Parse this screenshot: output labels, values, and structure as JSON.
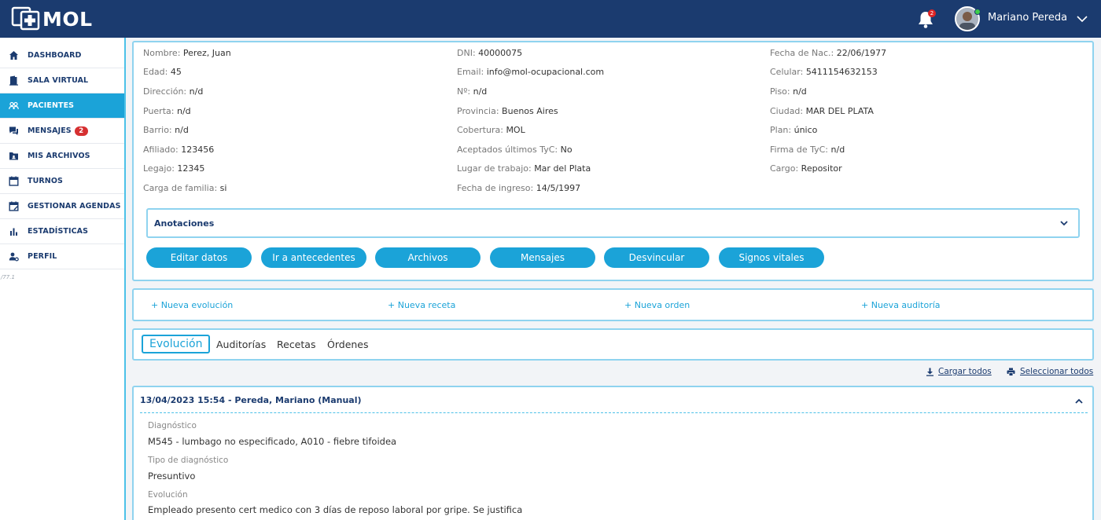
{
  "header": {
    "logo_text": "MOL",
    "notification_count": "2",
    "user_name": "Mariano Pereda"
  },
  "sidebar": {
    "items": [
      {
        "label": "DASHBOARD",
        "icon": "home-icon"
      },
      {
        "label": "SALA VIRTUAL",
        "icon": "door-icon"
      },
      {
        "label": "PACIENTES",
        "icon": "users-icon",
        "active": true
      },
      {
        "label": "MENSAJES",
        "icon": "chat-icon",
        "badge": "2"
      },
      {
        "label": "MIS ARCHIVOS",
        "icon": "folder-icon"
      },
      {
        "label": "TURNOS",
        "icon": "calendar-icon"
      },
      {
        "label": "GESTIONAR AGENDAS",
        "icon": "calendar-edit-icon"
      },
      {
        "label": "ESTADÍSTICAS",
        "icon": "bar-chart-icon"
      },
      {
        "label": "PERFIL",
        "icon": "user-gear-icon"
      }
    ],
    "version": "/77.1"
  },
  "patient": {
    "col1": [
      {
        "label": "Nombre:",
        "value": "Perez, Juan"
      },
      {
        "label": "Edad:",
        "value": "45"
      },
      {
        "label": "Dirección:",
        "value": "n/d"
      },
      {
        "label": "Puerta:",
        "value": "n/d"
      },
      {
        "label": "Barrio:",
        "value": "n/d"
      },
      {
        "label": "Afiliado:",
        "value": "123456"
      },
      {
        "label": "Legajo:",
        "value": "12345"
      },
      {
        "label": "Carga de familia:",
        "value": "si"
      }
    ],
    "col2": [
      {
        "label": "DNI:",
        "value": "40000075"
      },
      {
        "label": "Email:",
        "value": "info@mol-ocupacional.com"
      },
      {
        "label": "Nº:",
        "value": "n/d"
      },
      {
        "label": "Provincia:",
        "value": "Buenos Aires"
      },
      {
        "label": "Cobertura:",
        "value": "MOL"
      },
      {
        "label": "Aceptados últimos TyC:",
        "value": "No"
      },
      {
        "label": "Lugar de trabajo:",
        "value": "Mar del Plata"
      },
      {
        "label": "Fecha de ingreso:",
        "value": "14/5/1997"
      }
    ],
    "col3": [
      {
        "label": "Fecha de Nac.:",
        "value": "22/06/1977"
      },
      {
        "label": "Celular:",
        "value": "5411154632153"
      },
      {
        "label": "Piso:",
        "value": "n/d"
      },
      {
        "label": "Ciudad:",
        "value": "MAR DEL PLATA"
      },
      {
        "label": "Plan:",
        "value": "único"
      },
      {
        "label": "Firma de TyC:",
        "value": "n/d"
      },
      {
        "label": "Cargo:",
        "value": "Repositor"
      }
    ]
  },
  "annotations": {
    "label": "Anotaciones"
  },
  "buttons": {
    "edit": "Editar datos",
    "history": "Ir a antecedentes",
    "files": "Archivos",
    "messages": "Mensajes",
    "unlink": "Desvincular",
    "vitals": "Signos vitales"
  },
  "quick_actions": {
    "new_evolution": "+ Nueva evolución",
    "new_prescription": "+ Nueva receta",
    "new_order": "+ Nueva orden",
    "new_audit": "+ Nueva auditoría"
  },
  "tabs": {
    "evolution": "Evolución",
    "audits": "Auditorías",
    "prescriptions": "Recetas",
    "orders": "Órdenes"
  },
  "tools": {
    "load_all": "Cargar todos",
    "select_all": "Seleccionar todos"
  },
  "evolution_entry": {
    "header": "13/04/2023 15:54 - Pereda, Mariano (Manual)",
    "diagnosis_label": "Diagnóstico",
    "diagnosis_value": "M545 - lumbago no especificado, A010 - fiebre tifoidea",
    "diagnosis_type_label": "Tipo de diagnóstico",
    "diagnosis_type_value": "Presuntivo",
    "evolution_label": "Evolución",
    "evolution_value": "Empleado presento cert medico con 3 días de reposo laboral por gripe. Se justifica"
  }
}
